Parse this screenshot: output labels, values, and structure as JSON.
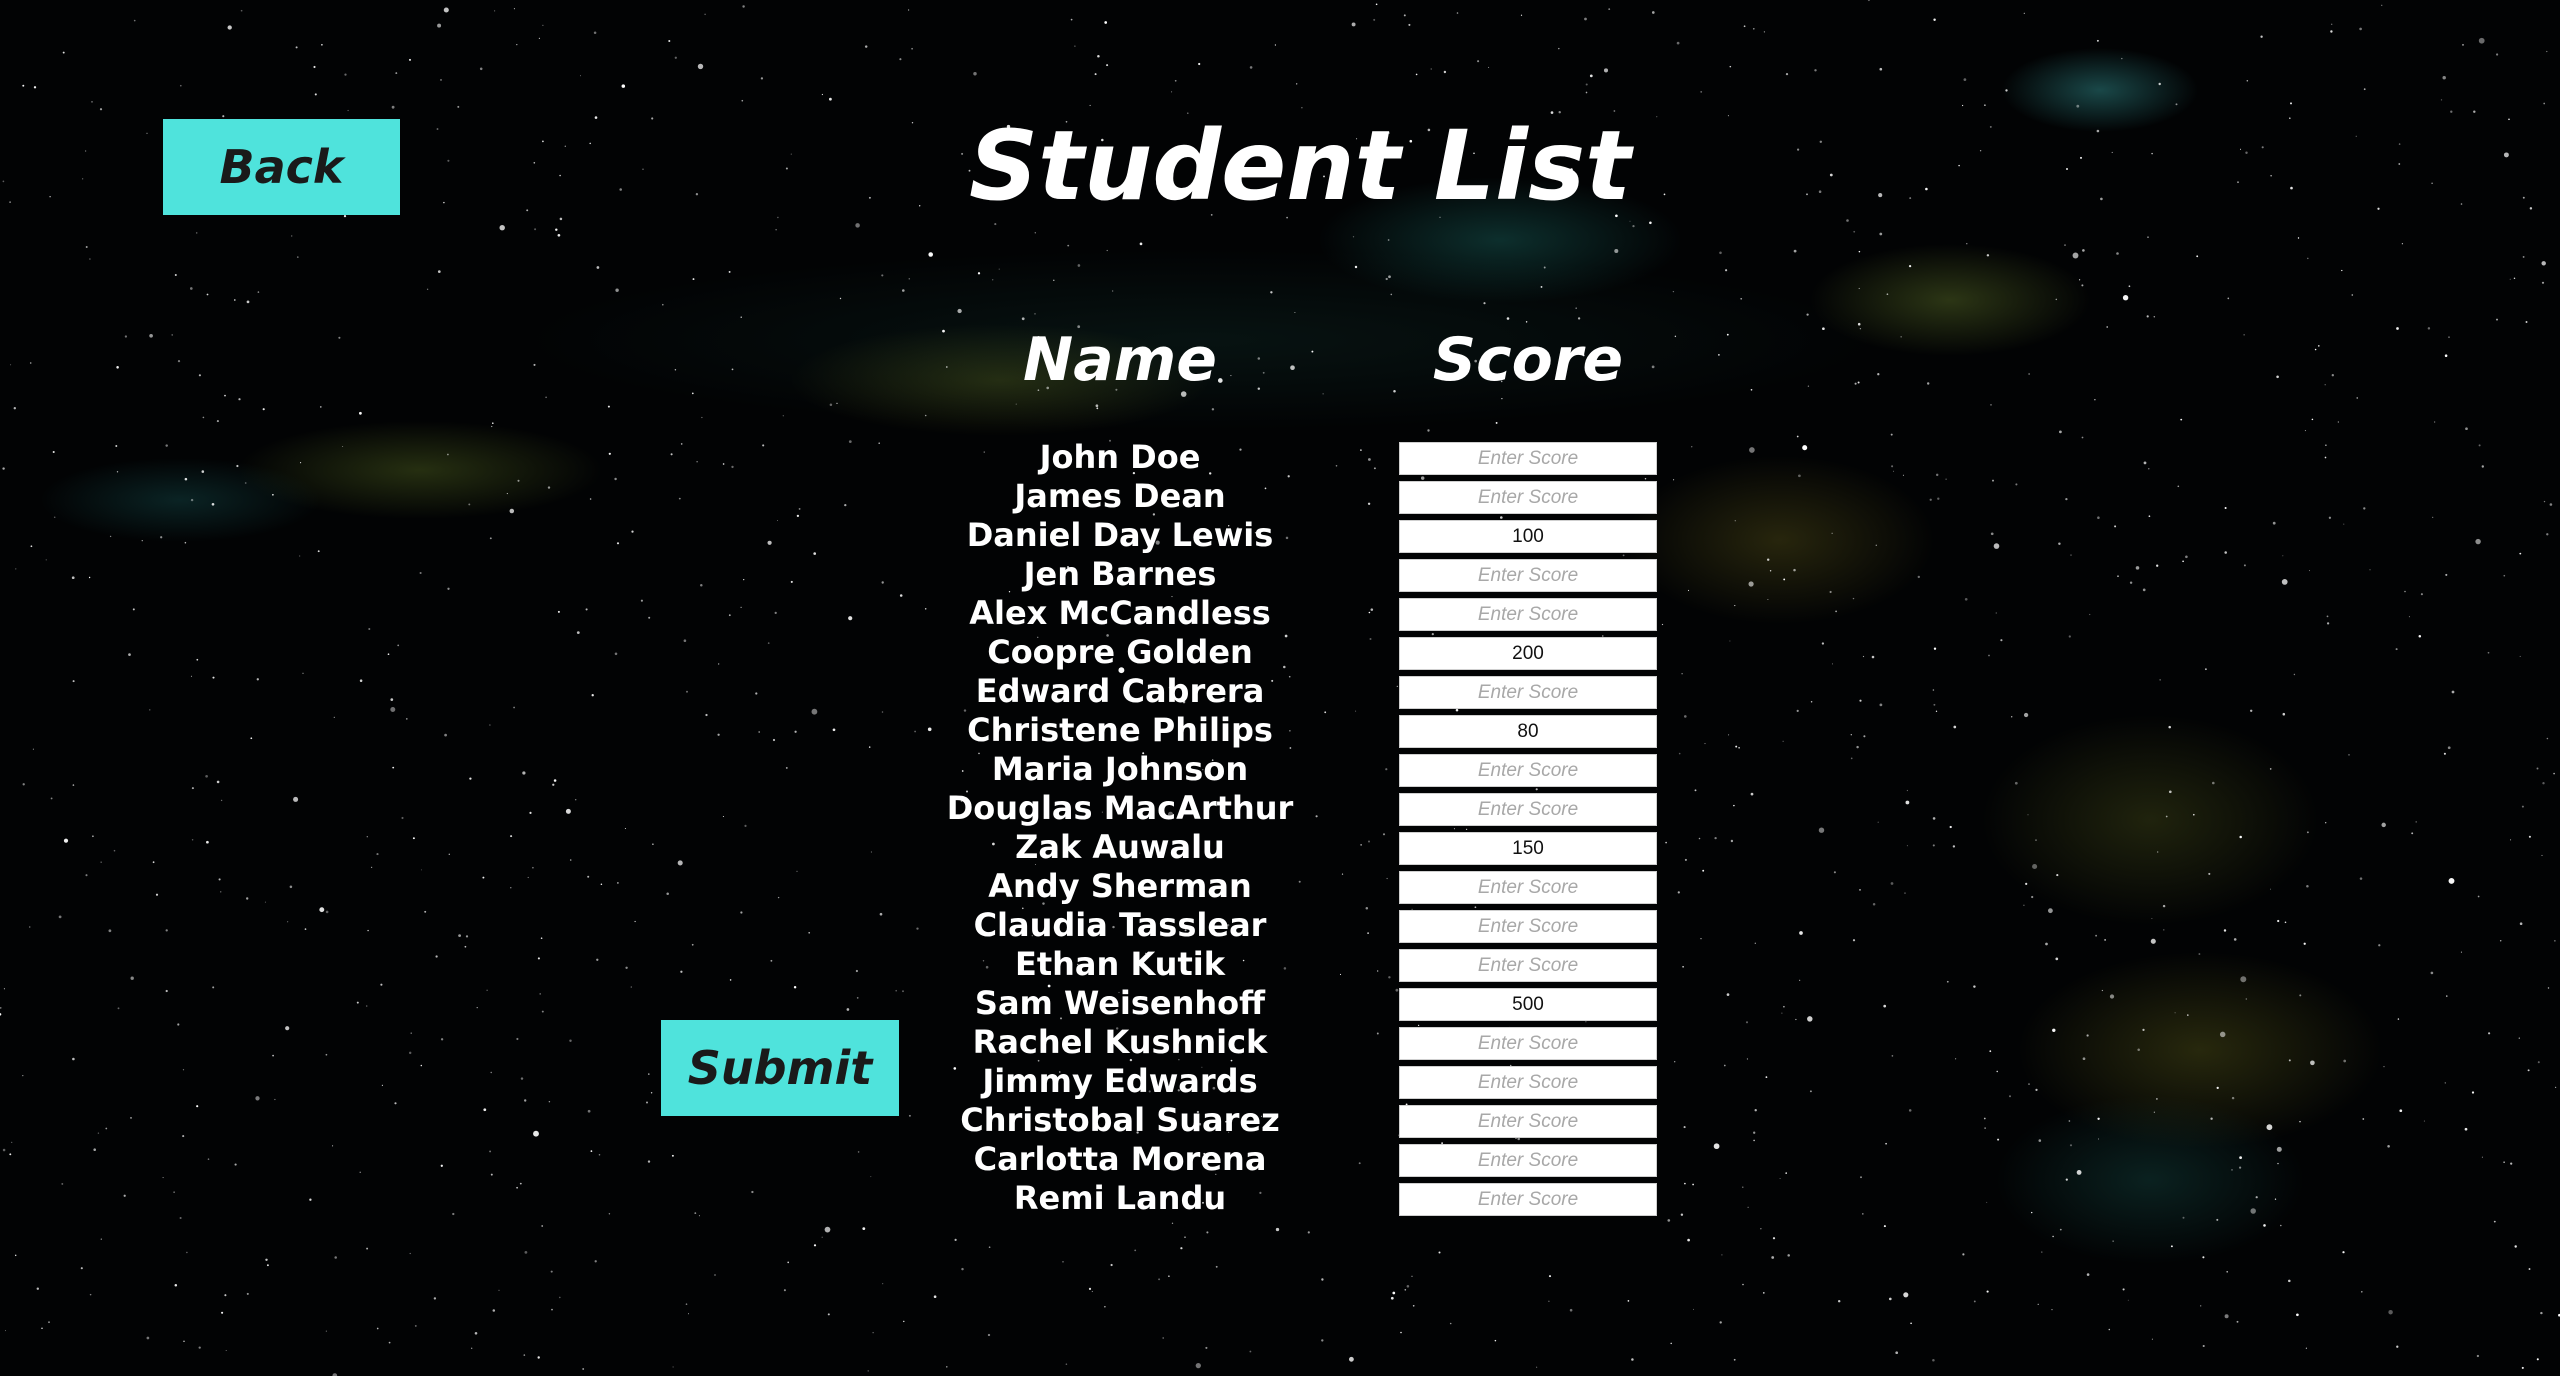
{
  "page": {
    "title": "Student List",
    "back_label": "Back",
    "submit_label": "Submit",
    "name_header": "Name",
    "score_header": "Score",
    "score_placeholder": "Enter Score"
  },
  "colors": {
    "button_bg": "#4fe3dc",
    "button_text": "#1a1a1a",
    "text": "#ffffff",
    "background": "#020304"
  },
  "students": [
    {
      "name": "John Doe",
      "score": ""
    },
    {
      "name": "James Dean",
      "score": ""
    },
    {
      "name": "Daniel Day Lewis",
      "score": "100"
    },
    {
      "name": "Jen Barnes",
      "score": ""
    },
    {
      "name": "Alex McCandless",
      "score": ""
    },
    {
      "name": "Coopre Golden",
      "score": "200"
    },
    {
      "name": "Edward Cabrera",
      "score": ""
    },
    {
      "name": "Christene Philips",
      "score": "80"
    },
    {
      "name": "Maria Johnson",
      "score": ""
    },
    {
      "name": "Douglas MacArthur",
      "score": ""
    },
    {
      "name": "Zak Auwalu",
      "score": "150"
    },
    {
      "name": "Andy Sherman",
      "score": ""
    },
    {
      "name": "Claudia Tasslear",
      "score": ""
    },
    {
      "name": "Ethan Kutik",
      "score": ""
    },
    {
      "name": "Sam Weisenhoff",
      "score": "500"
    },
    {
      "name": "Rachel Kushnick",
      "score": ""
    },
    {
      "name": "Jimmy Edwards",
      "score": ""
    },
    {
      "name": "Christobal Suarez",
      "score": ""
    },
    {
      "name": "Carlotta Morena",
      "score": ""
    },
    {
      "name": "Remi Landu",
      "score": ""
    }
  ]
}
